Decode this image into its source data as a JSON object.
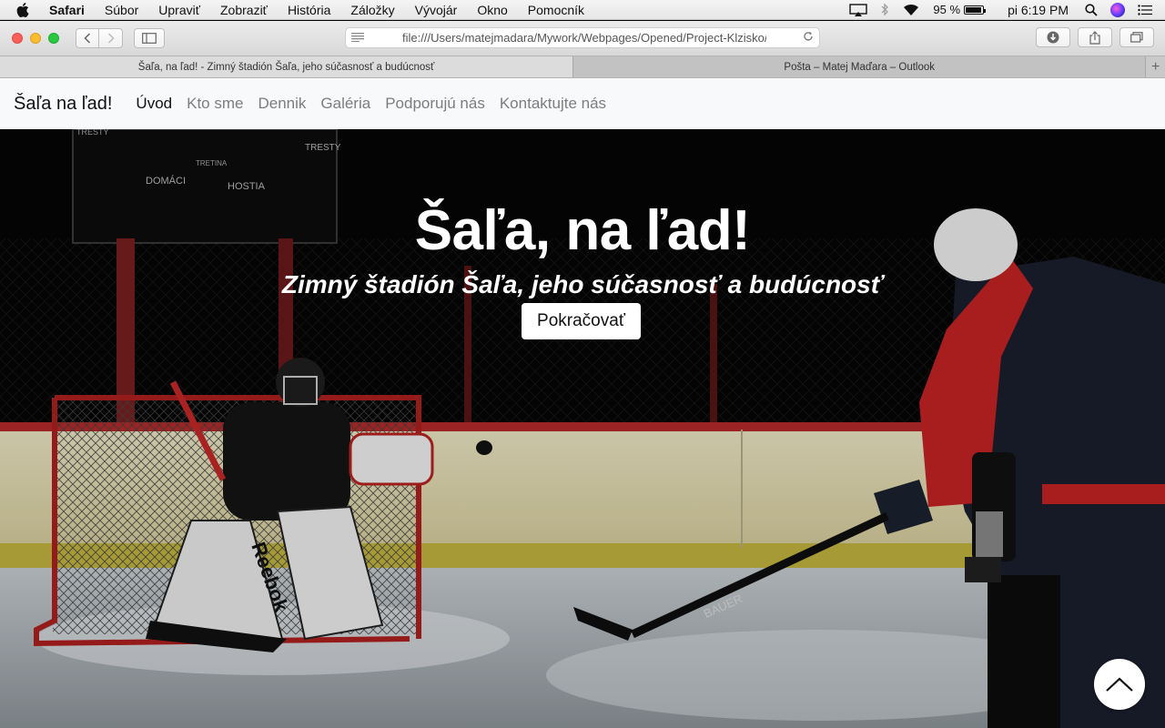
{
  "menubar": {
    "app_name": "Safari",
    "items": [
      "Súbor",
      "Upraviť",
      "Zobraziť",
      "História",
      "Záložky",
      "Vývojár",
      "Okno",
      "Pomocník"
    ],
    "battery": "95 %",
    "clock": "pi 6:19 PM"
  },
  "browser": {
    "url": "file:///Users/matejmadara/Mywork/Webpages/Opened/Project-Klzisko/",
    "tabs": [
      {
        "title": "Šaľa, na ľad! - Zimný štadión Šaľa, jeho súčasnosť a budúcnosť",
        "active": true
      },
      {
        "title": "Pošta – Matej Maďara – Outlook",
        "active": false
      }
    ]
  },
  "site": {
    "brand": "Šaľa na ľad!",
    "nav": [
      "Úvod",
      "Kto sme",
      "Dennik",
      "Galéria",
      "Podporujú nás",
      "Kontaktujte nás"
    ],
    "hero": {
      "title": "Šaľa, na ľad!",
      "subtitle": "Zimný štadión Šaľa, jeho súčasnosť a budúcnosť",
      "cta": "Pokračovať"
    },
    "scoreboard": {
      "left": "DOMÁCI",
      "right": "HOSTIA",
      "center": "TRETINA",
      "top_left": "TRESTY",
      "top_right": "TRESTY"
    },
    "pad_brand": "Reebok",
    "stick_brand": "BAUER"
  }
}
